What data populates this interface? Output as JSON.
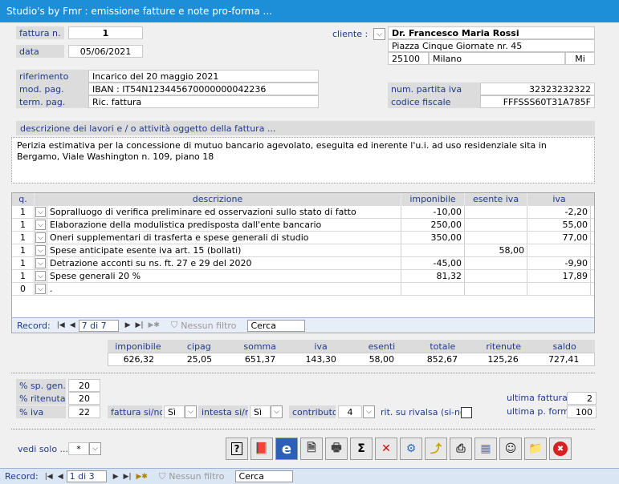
{
  "window": {
    "title": "Studio's by Fmr : emissione fatture e note pro-forma ..."
  },
  "header": {
    "fattura_label": "fattura n.",
    "fattura_value": "1",
    "data_label": "data",
    "data_value": "05/06/2021",
    "cliente_label": "cliente :",
    "cliente_name": "Dr. Francesco Maria Rossi",
    "cliente_address": "Piazza Cinque Giornate nr. 45",
    "cliente_cap": "25100",
    "cliente_city": "Milano",
    "cliente_prov": "Mi",
    "riferimento_label": "riferimento",
    "riferimento_value": "Incarico del 20 maggio 2021",
    "modpag_label": "mod. pag.",
    "modpag_value": "IBAN : IT54N123445670000000042236",
    "termpag_label": "term. pag.",
    "termpag_value": "Ric. fattura",
    "piva_label": "num. partita iva",
    "piva_value": "32323232322",
    "cf_label": "codice fiscale",
    "cf_value": "FFFSSS60T31A785F"
  },
  "description": {
    "label": "descrizione dei lavori e / o attività oggetto della fattura ...",
    "text": "Perizia estimativa per la concessione di mutuo bancario agevolato, eseguita ed inerente l'u.i. ad uso residenziale sita in Bergamo, Viale Washington n. 109, piano 18"
  },
  "items": {
    "columns": [
      "q.",
      "descrizione",
      "imponibile",
      "esente iva",
      "iva"
    ],
    "rows": [
      {
        "q": "1",
        "desc": "Sopralluogo di verifica preliminare ed osservazioni sullo stato di fatto",
        "imponibile": "-10,00",
        "esente": "",
        "iva": "-2,20"
      },
      {
        "q": "1",
        "desc": "Elaborazione della modulistica predisposta dall'ente bancario",
        "imponibile": "250,00",
        "esente": "",
        "iva": "55,00"
      },
      {
        "q": "1",
        "desc": "Oneri supplementari di trasferta e spese generali di studio",
        "imponibile": "350,00",
        "esente": "",
        "iva": "77,00"
      },
      {
        "q": "1",
        "desc": "Spese anticipate esente iva art. 15 (bollati)",
        "imponibile": "",
        "esente": "58,00",
        "iva": ""
      },
      {
        "q": "1",
        "desc": "Detrazione acconti su ns. ft. 27 e 29 del 2020",
        "imponibile": "-45,00",
        "esente": "",
        "iva": "-9,90"
      },
      {
        "q": "1",
        "desc": "Spese generali 20 %",
        "imponibile": "81,32",
        "esente": "",
        "iva": "17,89"
      },
      {
        "q": "0",
        "desc": ".",
        "imponibile": "",
        "esente": "",
        "iva": ""
      }
    ],
    "nav": {
      "label": "Record:",
      "position": "7 di 7",
      "filter": "Nessun filtro",
      "search": "Cerca"
    }
  },
  "totals": {
    "labels": [
      "imponibile",
      "cipag",
      "somma",
      "iva",
      "esenti",
      "totale",
      "ritenute",
      "saldo"
    ],
    "values": [
      "626,32",
      "25,05",
      "651,37",
      "143,30",
      "58,00",
      "852,67",
      "125,26",
      "727,41"
    ]
  },
  "settings": {
    "spgen_label": "% sp. gen.",
    "spgen_value": "20",
    "ritenuta_label": "% ritenuta",
    "ritenuta_value": "20",
    "iva_label": "% iva",
    "iva_value": "22",
    "fattura_sino_label": "fattura si/no",
    "fattura_sino_value": "Sì",
    "intesta_label": "intesta si/no",
    "intesta_value": "Sì",
    "contributo_label": "contributo",
    "contributo_value": "4",
    "rivalsa_label": "rit. su rivalsa (si-no)",
    "ultima_fattura_label": "ultima fattura",
    "ultima_fattura_value": "2",
    "ultima_forma_label": "ultima p. forma",
    "ultima_forma_value": "100"
  },
  "bottom": {
    "vedi_label": "vedi solo ...",
    "vedi_value": "*",
    "toolbar": [
      "help-icon",
      "book-icon",
      "explorer-icon",
      "preview-icon",
      "print-preview-icon",
      "sum-icon",
      "delete-icon",
      "settings-icon",
      "export-icon",
      "print-icon",
      "calculator-icon",
      "user-icon",
      "folder-icon",
      "close-icon"
    ],
    "sum_glyph": "Σ"
  },
  "status": {
    "label": "Record:",
    "position": "1 di 3",
    "filter": "Nessun filtro",
    "search": "Cerca"
  }
}
